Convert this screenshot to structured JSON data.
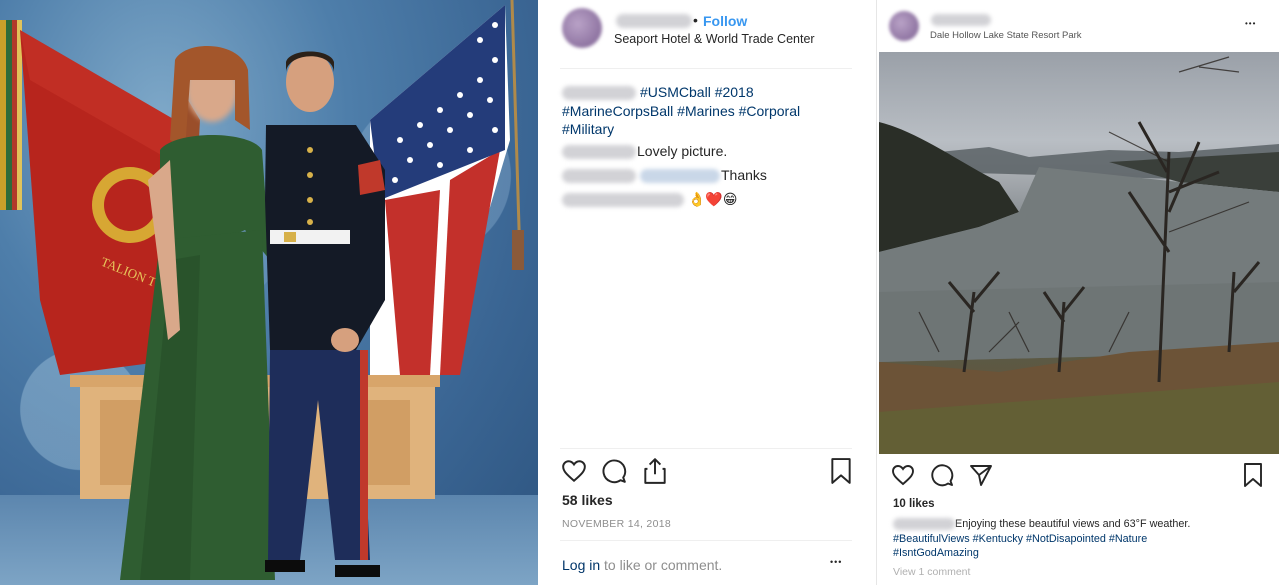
{
  "left_post": {
    "photo_alt": "Couple in formal attire in front of flags",
    "flag_text": "TALION TWEN"
  },
  "middle_post": {
    "follow_separator": "•",
    "follow_label": "Follow",
    "location": "Seaport Hotel & World Trade Center",
    "caption_lines": [
      "#USMCball #2018",
      "#MarineCorpsBall #Marines #Corporal",
      "#Military"
    ],
    "comments": [
      {
        "text": "Lovely picture."
      },
      {
        "text": "Thanks"
      },
      {
        "text": "👌❤️😁"
      }
    ],
    "likes": "58 likes",
    "date": "NOVEMBER 14, 2018",
    "login_link": "Log in",
    "login_rest": " to like or comment.",
    "more_label": "•••"
  },
  "right_post": {
    "location": "Dale Hollow Lake State Resort Park",
    "more_label": "•••",
    "likes": "10 likes",
    "caption_text": "Enjoying these beautiful views and 63°F weather.",
    "caption_tags": "#BeautifulViews #Kentucky #NotDisapointed #Nature",
    "caption_tags_2": "#IsntGodAmazing",
    "view_comments": "View 1 comment"
  },
  "icons": {
    "like": "heart-icon",
    "comment": "comment-icon",
    "share": "share-icon",
    "save": "bookmark-icon",
    "send": "send-icon"
  }
}
